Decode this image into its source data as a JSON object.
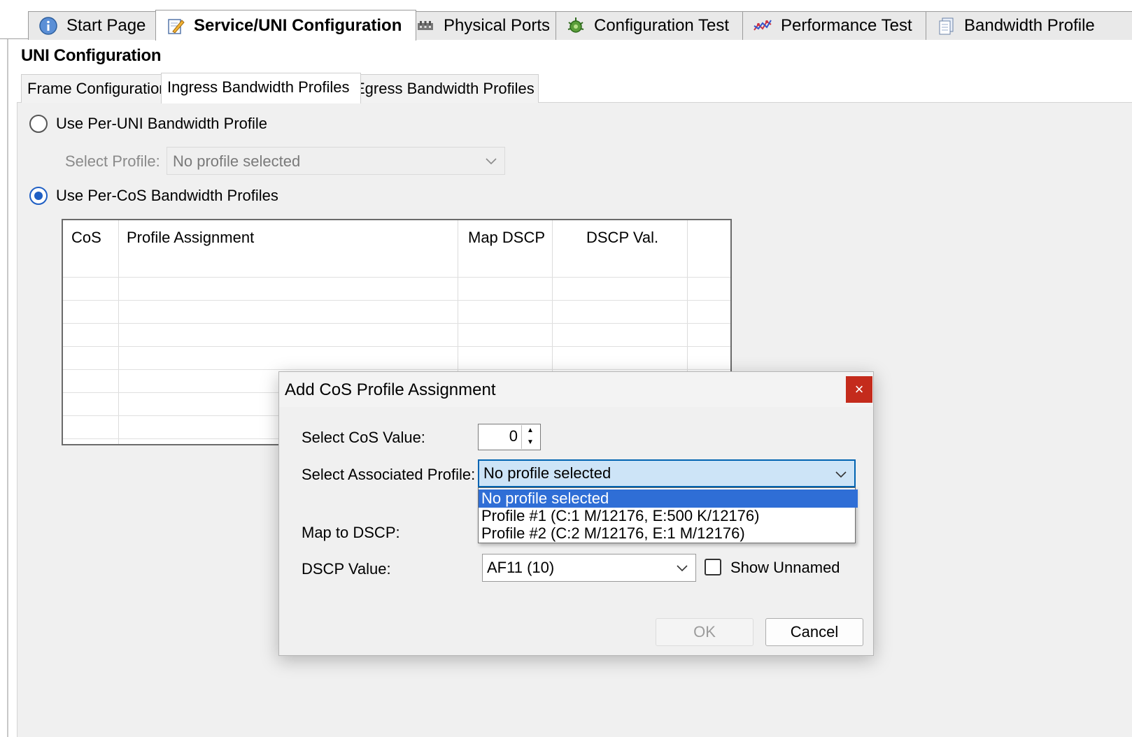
{
  "top_tabs": [
    {
      "label": "Start Page",
      "icon": "info-icon"
    },
    {
      "label": "Service/UNI Configuration",
      "icon": "edit-config-icon",
      "active": true
    },
    {
      "label": "Physical Ports",
      "icon": "ports-icon"
    },
    {
      "label": "Configuration Test",
      "icon": "gear-bug-icon"
    },
    {
      "label": "Performance Test",
      "icon": "line-graph-icon"
    },
    {
      "label": "Bandwidth Profile",
      "icon": "document-stack-icon"
    }
  ],
  "section_title": "UNI Configuration",
  "sub_tabs": [
    "Frame Configuration",
    "Ingress Bandwidth Profiles",
    "Egress Bandwidth Profiles"
  ],
  "per_uni": {
    "radio_label": "Use Per-UNI Bandwidth Profile",
    "select_label": "Select Profile:",
    "select_value": "No profile selected"
  },
  "per_cos": {
    "radio_label": "Use Per-CoS Bandwidth Profiles"
  },
  "grid": {
    "columns": [
      "CoS",
      "Profile Assignment",
      "Map DSCP",
      "DSCP Val."
    ],
    "rows": []
  },
  "dialog": {
    "title": "Add CoS Profile Assignment",
    "close_glyph": "×",
    "cos_label": "Select CoS Value:",
    "cos_value": "0",
    "profile_label": "Select Associated Profile:",
    "profile_value": "No profile selected",
    "profile_options": [
      "No profile selected",
      "Profile #1 (C:1 M/12176, E:500 K/12176)",
      "Profile #2 (C:2 M/12176, E:1 M/12176)"
    ],
    "map_label": "Map to DSCP:",
    "dscp_label": "DSCP Value:",
    "dscp_value": "AF11 (10)",
    "show_unnamed_label": "Show Unnamed",
    "ok_label": "OK",
    "cancel_label": "Cancel"
  },
  "colors": {
    "accent": "#1f5fc4",
    "selection": "#2f6ed6",
    "close": "#c42b1c"
  }
}
